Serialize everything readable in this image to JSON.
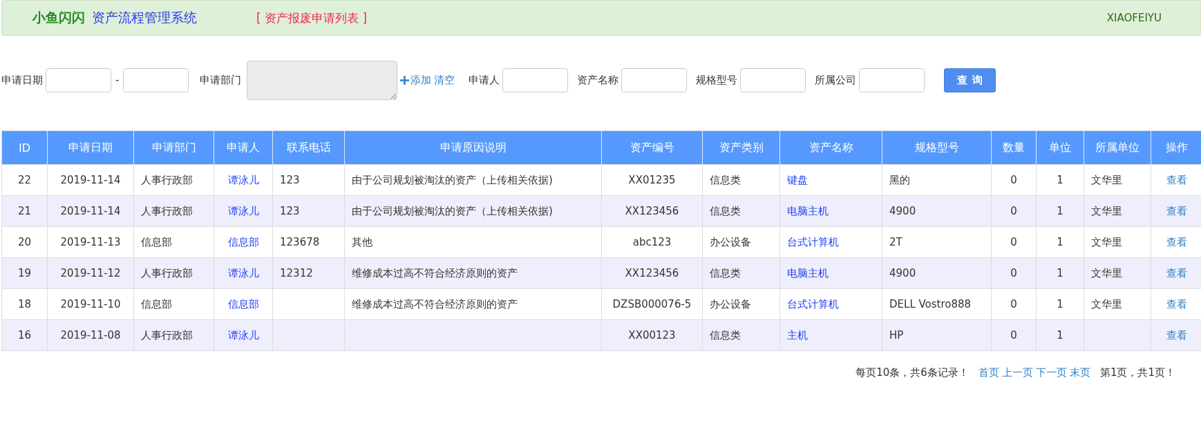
{
  "header": {
    "brand": "小鱼闪闪",
    "system_title": "资产流程管理系统",
    "page_title": "[ 资产报废申请列表 ]",
    "user": "XIAOFEIYU"
  },
  "filters": {
    "date_label": "申请日期",
    "date_separator": "-",
    "department_label": "申请部门",
    "department_disabled": true,
    "department_actions": [
      "添加",
      "清空"
    ],
    "fields": [
      {
        "label": "申请人"
      },
      {
        "label": "资产名称"
      },
      {
        "label": "规格型号"
      },
      {
        "label": "所属公司"
      }
    ],
    "search_button": "查 询"
  },
  "table": {
    "columns": [
      "ID",
      "申请日期",
      "申请部门",
      "申请人",
      "联系电话",
      "申请原因说明",
      "资产编号",
      "资产类别",
      "资产名称",
      "规格型号",
      "数量",
      "单位",
      "所属单位",
      "操作"
    ],
    "rows": [
      {
        "cells": [
          "22",
          "2019-11-14",
          "人事行政部",
          "谭泳儿",
          "123",
          "由于公司规划被淘汰的资产（上传相关依据)",
          "XX01235",
          "信息类",
          "键盘",
          "黑的",
          "0",
          "1",
          "文华里",
          "查看"
        ]
      },
      {
        "cells": [
          "21",
          "2019-11-14",
          "人事行政部",
          "谭泳儿",
          "123",
          "由于公司规划被淘汰的资产（上传相关依据)",
          "XX123456",
          "信息类",
          "电脑主机",
          "4900",
          "0",
          "1",
          "文华里",
          "查看"
        ]
      },
      {
        "cells": [
          "20",
          "2019-11-13",
          "信息部",
          "信息部",
          "123678",
          "其他",
          "abc123",
          "办公设备",
          "台式计算机",
          "2T",
          "0",
          "1",
          "文华里",
          "查看"
        ]
      },
      {
        "cells": [
          "19",
          "2019-11-12",
          "人事行政部",
          "谭泳儿",
          "12312",
          "维修成本过高不符合经济原则的资产",
          "XX123456",
          "信息类",
          "电脑主机",
          "4900",
          "0",
          "1",
          "文华里",
          "查看"
        ]
      },
      {
        "cells": [
          "18",
          "2019-11-10",
          "信息部",
          "信息部",
          "",
          "维修成本过高不符合经济原则的资产",
          "DZSB000076-5",
          "办公设备",
          "台式计算机",
          "DELL Vostro888",
          "0",
          "1",
          "文华里",
          "查看"
        ]
      },
      {
        "cells": [
          "16",
          "2019-11-08",
          "人事行政部",
          "谭泳儿",
          "",
          "",
          "XX00123",
          "信息类",
          "主机",
          "HP",
          "0",
          "1",
          "",
          "查看"
        ]
      }
    ]
  },
  "pager": {
    "summary": "每页10条，共6条记录！",
    "links": [
      "首页",
      "上一页",
      "下一页",
      "末页"
    ],
    "status": "第1页，共1页！"
  }
}
